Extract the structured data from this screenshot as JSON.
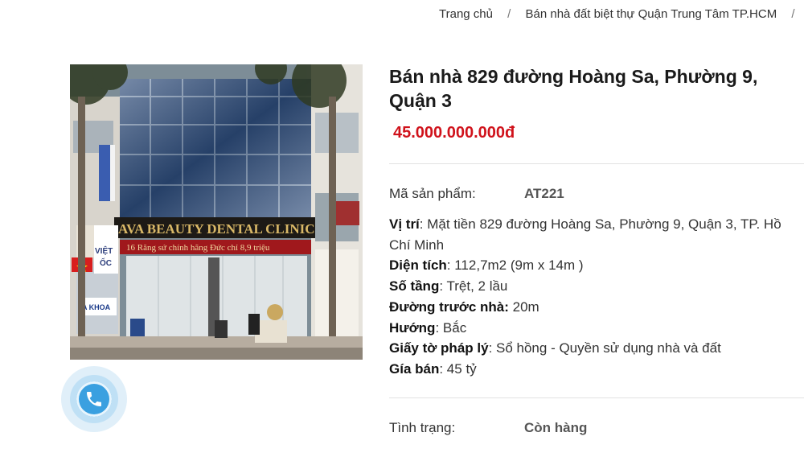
{
  "breadcrumb": {
    "home": "Trang chủ",
    "separator": "/",
    "category": "Bán nhà đất biệt thự Quận Trung Tâm TP.HCM",
    "trailing_separator": "/"
  },
  "photo": {
    "sign_main": "AVA BEAUTY DENTAL CLINIC",
    "sign_sub": "16 Răng sứ chính hãng Đức chỉ 8,9 triệu",
    "side_sign_1": "VIỆT",
    "side_sign_2": "ỐC",
    "side_sign_3": "A KHOA"
  },
  "call_button": {
    "icon": "phone-icon"
  },
  "product": {
    "title": "Bán nhà 829 đường Hoàng Sa, Phường 9, Quận 3",
    "price": "45.000.000.000đ",
    "sku_label": "Mã sản phẩm:",
    "sku_value": "AT221",
    "specs": {
      "location_label": "Vị trí",
      "location_value": ": Mặt tiền 829 đường Hoàng Sa, Phường 9, Quận 3, TP. Hồ Chí Minh",
      "area_label": "Diện tích",
      "area_value": ": 112,7m2 (9m x 14m )",
      "floors_label": "Số tầng",
      "floors_value": ":  Trệt, 2 lầu",
      "road_label": "Đường trước nhà:",
      "road_value": " 20m",
      "direction_label": "Hướng",
      "direction_value": ": Bắc",
      "legal_label": "Giấy tờ pháp lý",
      "legal_value": ": Sổ hồng - Quyền sử dụng nhà và đất",
      "price_label": "Gía bán",
      "price_value": ": 45 tỷ"
    },
    "status_label": "Tình trạng:",
    "status_value": "Còn hàng"
  },
  "colors": {
    "price": "#d0121b",
    "call_button": "#3aa0e0"
  }
}
